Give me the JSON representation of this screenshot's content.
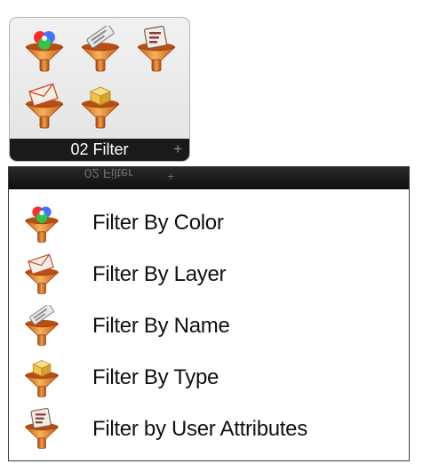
{
  "panel": {
    "footer_label": "02 Filter",
    "expand_glyph": "+",
    "tools": [
      {
        "icon": "filter-by-color-icon"
      },
      {
        "icon": "filter-by-name-icon"
      },
      {
        "icon": "filter-by-user-attributes-icon"
      },
      {
        "icon": "filter-by-layer-icon"
      },
      {
        "icon": "filter-by-type-icon"
      }
    ]
  },
  "menu": {
    "header_reflection": "02 Filter",
    "items": [
      {
        "label": "Filter By Color",
        "icon": "filter-by-color-icon"
      },
      {
        "label": "Filter By Layer",
        "icon": "filter-by-layer-icon"
      },
      {
        "label": "Filter By Name",
        "icon": "filter-by-name-icon"
      },
      {
        "label": "Filter By Type",
        "icon": "filter-by-type-icon"
      },
      {
        "label": "Filter by User Attributes",
        "icon": "filter-by-user-attributes-icon"
      }
    ]
  },
  "colors": {
    "funnel_light": "#f2a34a",
    "funnel_dark": "#b24d12",
    "footer_bg": "#1a1a1a"
  }
}
